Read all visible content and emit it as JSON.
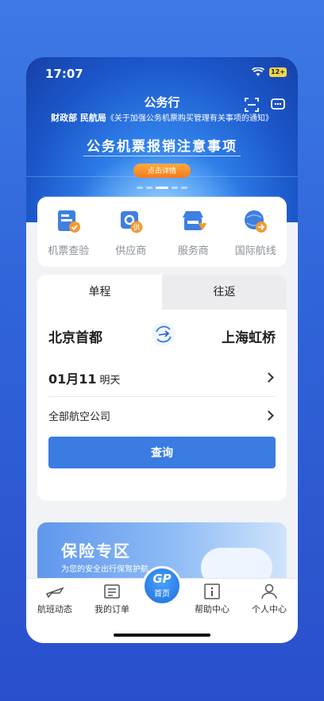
{
  "status": {
    "time": "17:07",
    "battery": "12+"
  },
  "banner": {
    "title": "公务行",
    "subtitle_bold": "财政部 民航局",
    "subtitle_rest": "《关于加强公务机票购买管理有关事项的通知》",
    "headline": "公务机票报销注意事项",
    "detail_button": "点击详情"
  },
  "quick_entries": [
    {
      "label": "机票查验",
      "icon": "ticket-check-icon"
    },
    {
      "label": "供应商",
      "icon": "supplier-icon"
    },
    {
      "label": "服务商",
      "icon": "service-provider-icon"
    },
    {
      "label": "国际航线",
      "icon": "international-route-icon"
    }
  ],
  "booking": {
    "tabs": [
      "单程",
      "往返"
    ],
    "from_city": "北京首都",
    "to_city": "上海虹桥",
    "date": "01月11",
    "date_note": "明天",
    "airline": "全部航空公司",
    "search_button": "查询"
  },
  "insurance": {
    "title": "保险专区",
    "subtitle": "为您的安全出行保驾护航"
  },
  "tabbar": {
    "items": [
      "航班动态",
      "我的订单",
      "首页",
      "帮助中心",
      "个人中心"
    ],
    "home_logo": "GP"
  },
  "colors": {
    "primary": "#3a7ce2",
    "orange": "#f47b1c"
  }
}
